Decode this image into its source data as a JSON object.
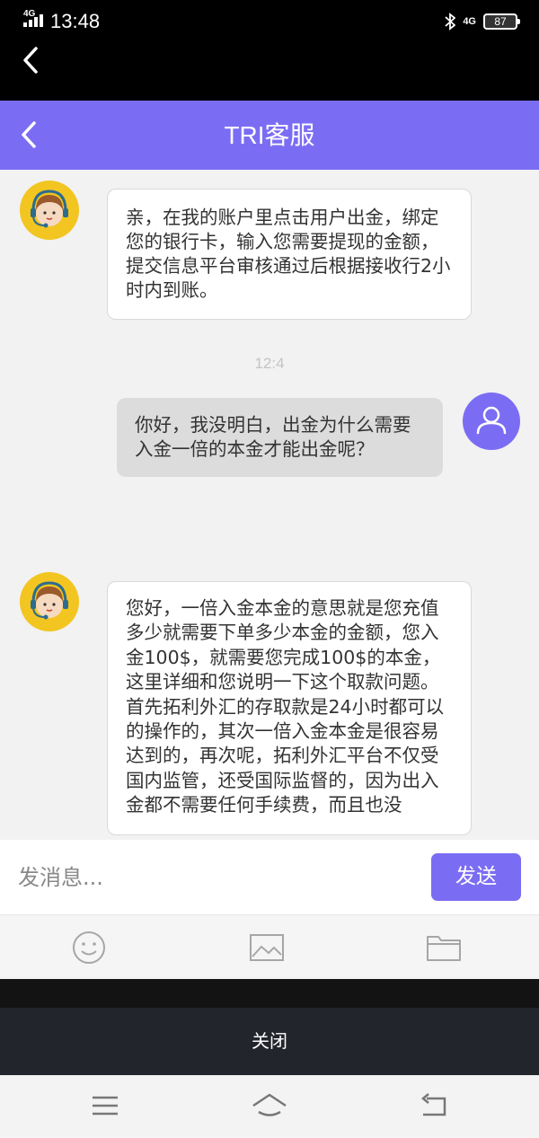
{
  "status_bar": {
    "network_left": "4G",
    "time": "13:48",
    "network_right": "4G",
    "battery": "87"
  },
  "header": {
    "title": "TRI客服"
  },
  "messages": [
    {
      "sender": "agent",
      "text": "亲，在我的账户里点击用户出金，绑定您的银行卡，输入您需要提现的金额，提交信息平台审核通过后根据接收行2小时内到账。"
    },
    {
      "sender": "timestamp",
      "text": "12:4"
    },
    {
      "sender": "user",
      "text": "你好，我没明白，出金为什么需要入金一倍的本金才能出金呢？"
    },
    {
      "sender": "agent",
      "text": "您好，一倍入金本金的意思就是您充值多少就需要下单多少本金的金额，您入金100$，就需要您完成100$的本金，这里详细和您说明一下这个取款问题。首先拓利外汇的存取款是24小时都可以的操作的，其次一倍入金本金是很容易达到的，再次呢，拓利外汇平台不仅受国内监管，还受国际监督的，因为出入金都不需要任何手续费，而且也没"
    }
  ],
  "composer": {
    "placeholder": "发消息...",
    "send_label": "发送"
  },
  "toolbar": {
    "icons": [
      "emoji-icon",
      "image-icon",
      "folder-icon"
    ]
  },
  "close_label": "关闭",
  "colors": {
    "accent": "#7b6df3",
    "agent_avatar_bg": "#f2c521",
    "user_bubble": "#dcdcdc"
  }
}
